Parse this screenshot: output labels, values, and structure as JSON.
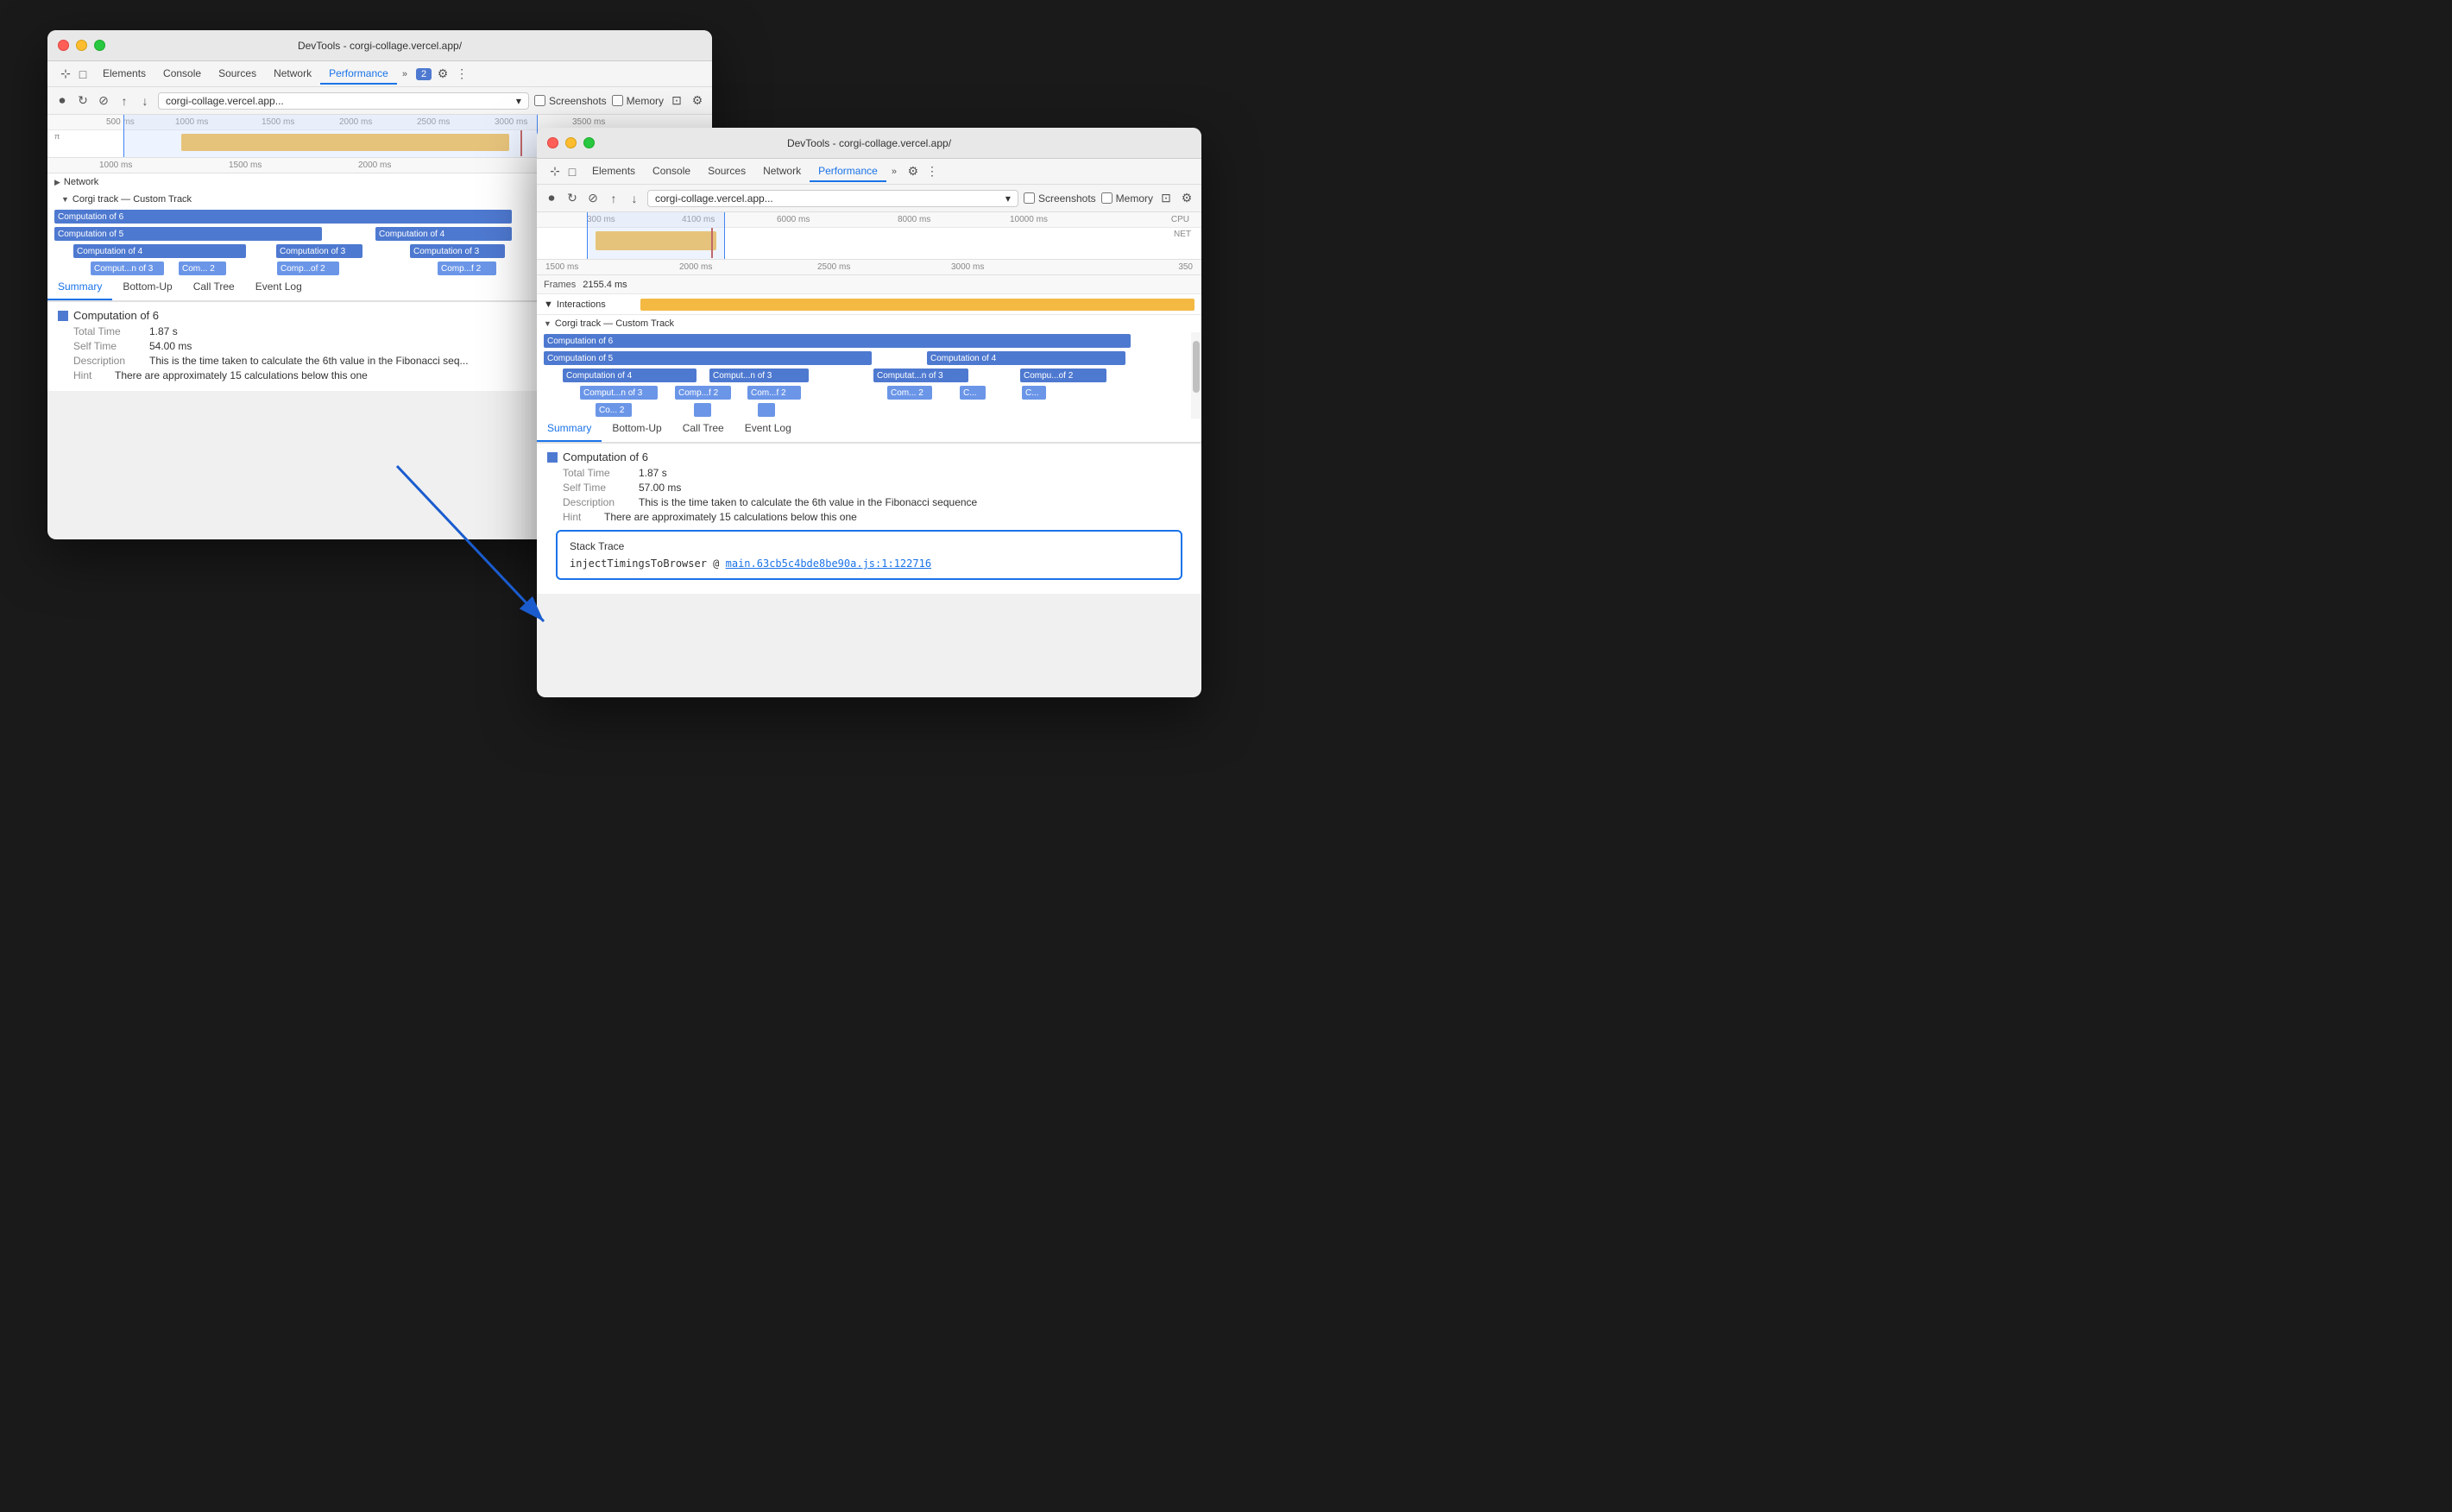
{
  "window1": {
    "title": "DevTools - corgi-collage.vercel.app/",
    "tabs": [
      "Elements",
      "Console",
      "Sources",
      "Network",
      "Performance"
    ],
    "active_tab": "Performance",
    "url": "corgi-collage.vercel.app...",
    "checkboxes": [
      "Screenshots",
      "Memory"
    ],
    "ruler_marks": [
      "500 ms",
      "1000 ms",
      "1500 ms",
      "2000 ms",
      "2500 ms",
      "3000 ms",
      "3500 ms"
    ],
    "zoom_ruler": [
      "1000 ms",
      "1500 ms",
      "2000 ms"
    ],
    "network_label": "Network",
    "custom_track_label": "Corgi track — Custom Track",
    "flame_bars": [
      {
        "label": "Computation of 6",
        "level": 0
      },
      {
        "label": "Computation of 5",
        "level": 1
      },
      {
        "label": "Computation of 4",
        "level": 1
      },
      {
        "label": "Computation of 4",
        "level": 2
      },
      {
        "label": "Computation of 3",
        "level": 2
      },
      {
        "label": "Computation of 3",
        "level": 2
      },
      {
        "label": "Comput...n of 3",
        "level": 3
      },
      {
        "label": "Com... 2",
        "level": 3
      },
      {
        "label": "Comp...of 2",
        "level": 3
      },
      {
        "label": "Comp...f 2",
        "level": 3
      }
    ],
    "summary_tabs": [
      "Summary",
      "Bottom-Up",
      "Call Tree",
      "Event Log"
    ],
    "active_summary_tab": "Summary",
    "selected_item": "Computation of 6",
    "total_time": "1.87 s",
    "self_time": "54.00 ms",
    "description": "This is the time taken to calculate the 6th value in the Fibonacci seq...",
    "hint": "There are approximately 15 calculations below this one"
  },
  "window2": {
    "title": "DevTools - corgi-collage.vercel.app/",
    "tabs": [
      "Elements",
      "Console",
      "Sources",
      "Network",
      "Performance"
    ],
    "active_tab": "Performance",
    "url": "corgi-collage.vercel.app...",
    "checkboxes": [
      "Screenshots",
      "Memory"
    ],
    "ruler_marks_top": [
      "300 ms",
      "4100 ms",
      "6000 ms",
      "8000 ms",
      "10000 ms"
    ],
    "ruler_marks_main": [
      "1500 ms",
      "2000 ms",
      "2500 ms",
      "3000 ms",
      "350"
    ],
    "cpu_label": "CPU",
    "net_label": "NET",
    "frames_label": "Frames",
    "frames_value": "2155.4 ms",
    "interactions_label": "Interactions",
    "custom_track_label": "Corgi track — Custom Track",
    "flame_bars_2": [
      {
        "label": "Computation of 6",
        "level": 0
      },
      {
        "label": "Computation of 5",
        "level": 1
      },
      {
        "label": "Computation of 4",
        "level": 1
      },
      {
        "label": "Computation of 4",
        "level": 2
      },
      {
        "label": "Comput...n of 3",
        "level": 2
      },
      {
        "label": "Computat...n of 3",
        "level": 2
      },
      {
        "label": "Compu...of 2",
        "level": 2
      },
      {
        "label": "Comput...n of 3",
        "level": 3
      },
      {
        "label": "Comp...f 2",
        "level": 3
      },
      {
        "label": "Com...f 2",
        "level": 3
      },
      {
        "label": "Com... 2",
        "level": 3
      },
      {
        "label": "C...",
        "level": 3
      },
      {
        "label": "C...",
        "level": 3
      },
      {
        "label": "Co... 2",
        "level": 4
      }
    ],
    "summary_tabs": [
      "Summary",
      "Bottom-Up",
      "Call Tree",
      "Event Log"
    ],
    "active_summary_tab": "Summary",
    "selected_item": "Computation of 6",
    "total_time": "1.87 s",
    "self_time": "57.00 ms",
    "description": "This is the time taken to calculate the 6th value in the Fibonacci sequence",
    "hint": "There are approximately 15 calculations below this one",
    "stack_trace_title": "Stack Trace",
    "stack_trace_fn": "injectTimingsToBrowser @",
    "stack_trace_link": "main.63cb5c4bde8be90a.js:1:122716"
  },
  "arrow": {
    "visible": true
  },
  "labels": {
    "total_time": "Total Time",
    "self_time": "Self Time",
    "description": "Description",
    "hint": "Hint"
  }
}
